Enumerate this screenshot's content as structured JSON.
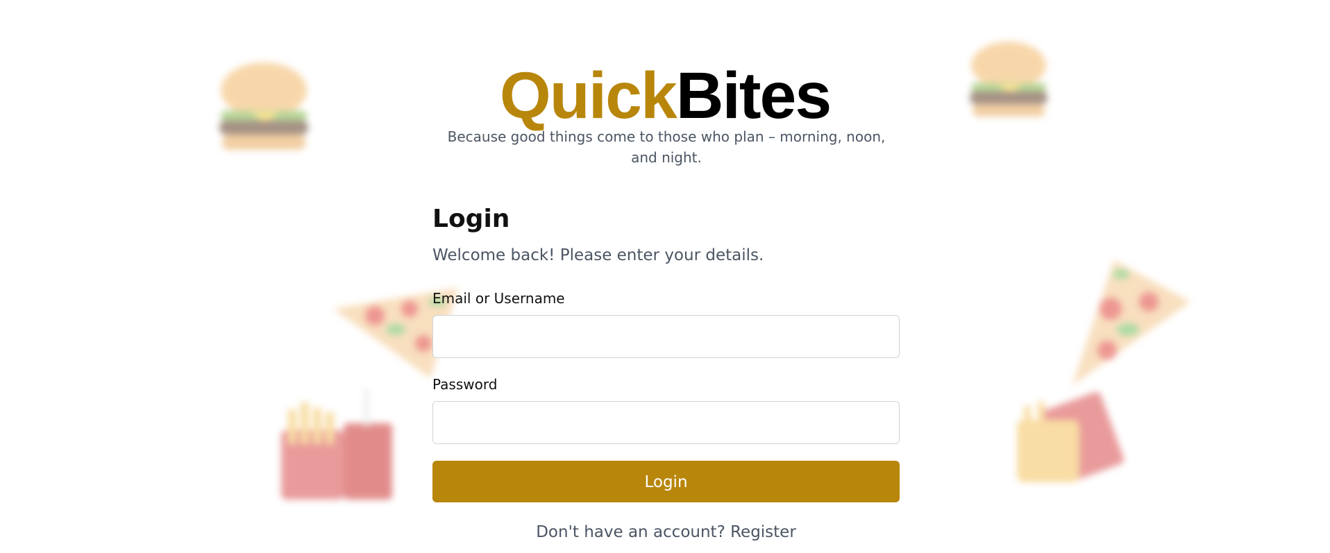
{
  "brand": {
    "name_part1": "Quick",
    "name_part2": "Bites",
    "tagline": "Because good things come to those who plan – morning, noon, and night.",
    "accent_color": "#b8860b"
  },
  "login": {
    "title": "Login",
    "subtitle": "Welcome back! Please enter your details.",
    "email_label": "Email or Username",
    "email_value": "",
    "email_placeholder": "",
    "password_label": "Password",
    "password_value": "",
    "password_placeholder": "",
    "submit_label": "Login",
    "register_prompt": "Don't have an account?",
    "register_link": "Register"
  },
  "decorations": {
    "images": [
      "burger-image",
      "burger-image",
      "pizza-slice-image",
      "fries-and-drink-image",
      "pizza-slice-image",
      "fries-image"
    ]
  }
}
